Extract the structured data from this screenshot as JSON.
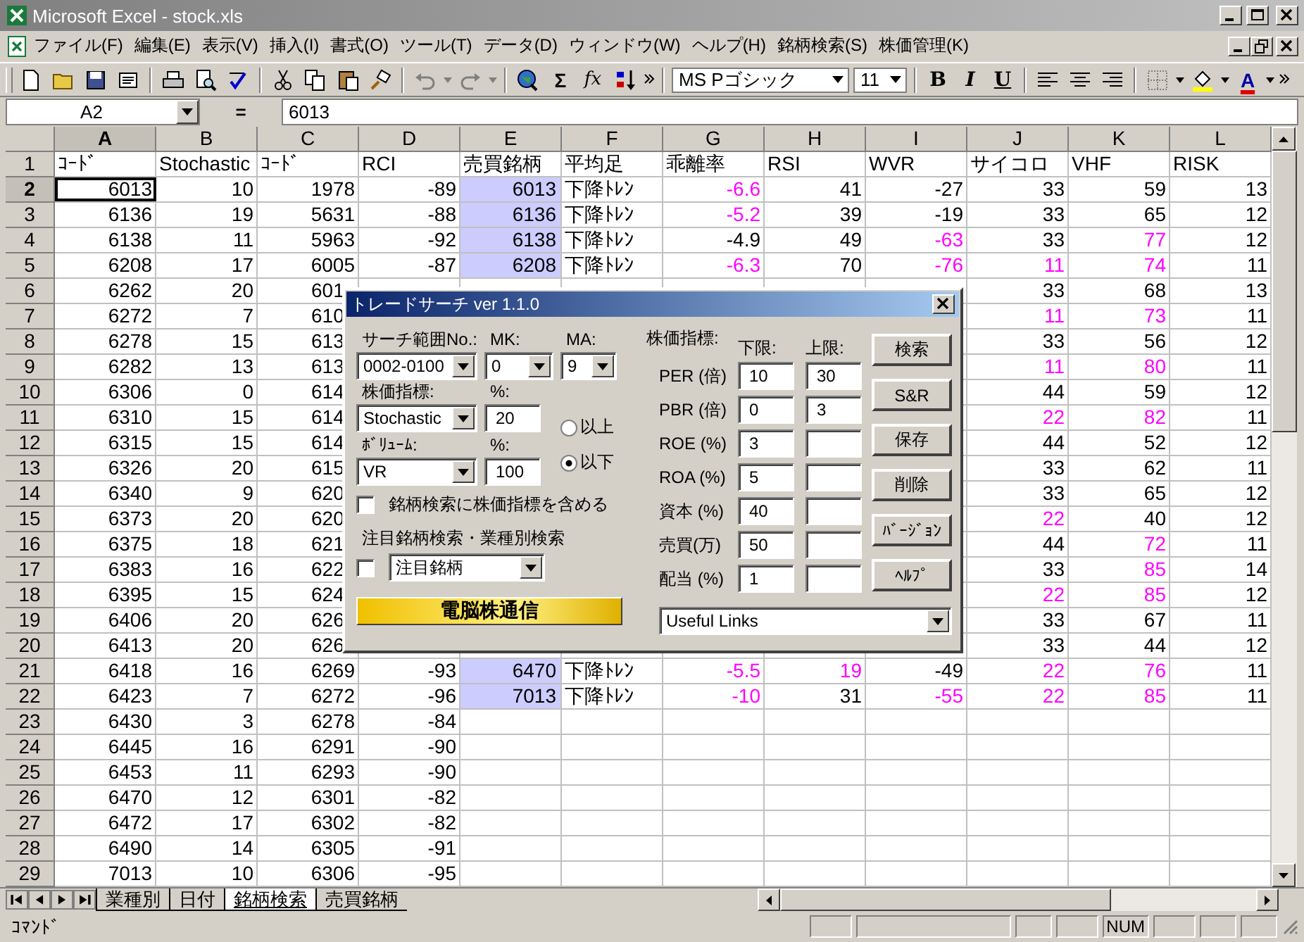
{
  "window": {
    "title": "Microsoft Excel - stock.xls"
  },
  "menu": [
    "ファイル(F)",
    "編集(E)",
    "表示(V)",
    "挿入(I)",
    "書式(O)",
    "ツール(T)",
    "データ(D)",
    "ウィンドウ(W)",
    "ヘルプ(H)",
    "銘柄検索(S)",
    "株価管理(K)"
  ],
  "toolbar": {
    "sum": "Σ",
    "function": "fx",
    "font": "MS Pゴシック",
    "size": "11",
    "bold": "B",
    "italic": "I",
    "underline": "U",
    "font_color": "A"
  },
  "formula_bar": {
    "name_box": "A2",
    "equals": "=",
    "value": "6013"
  },
  "columns": [
    {
      "letter": "A",
      "selected": true,
      "highlighted": false
    },
    {
      "letter": "B",
      "selected": false,
      "highlighted": false
    },
    {
      "letter": "C",
      "selected": false,
      "highlighted": false
    },
    {
      "letter": "D",
      "selected": false,
      "highlighted": false
    },
    {
      "letter": "E",
      "selected": false,
      "highlighted": true
    },
    {
      "letter": "F",
      "selected": false,
      "highlighted": false
    },
    {
      "letter": "G",
      "selected": false,
      "highlighted": false
    },
    {
      "letter": "H",
      "selected": false,
      "highlighted": false
    },
    {
      "letter": "I",
      "selected": false,
      "highlighted": false
    },
    {
      "letter": "J",
      "selected": false,
      "highlighted": false
    },
    {
      "letter": "K",
      "selected": false,
      "highlighted": false
    },
    {
      "letter": "L",
      "selected": false,
      "highlighted": false
    }
  ],
  "rows": [
    {
      "number": "1",
      "selected": false,
      "covered": false,
      "shaded": false,
      "cells": [
        "ｺｰﾄﾞ",
        "Stochastic",
        "ｺｰﾄﾞ",
        "RCI",
        "売買銘柄",
        "平均足",
        "乖離率",
        "RSI",
        "WVR",
        "サイコロ",
        "VHF",
        "RISK"
      ],
      "pink": [
        false,
        false,
        false,
        false,
        false,
        false,
        false,
        false,
        false,
        false,
        false,
        false
      ]
    },
    {
      "number": "2",
      "selected": true,
      "covered": false,
      "shaded": true,
      "cells": [
        "6013",
        "10",
        "1978",
        "-89",
        "6013",
        "下降ﾄﾚﾝ",
        "-6.6",
        "41",
        "-27",
        "33",
        "59",
        "13"
      ],
      "pink": [
        false,
        false,
        false,
        false,
        false,
        false,
        true,
        false,
        false,
        false,
        false,
        false
      ]
    },
    {
      "number": "3",
      "selected": false,
      "covered": false,
      "shaded": true,
      "cells": [
        "6136",
        "19",
        "5631",
        "-88",
        "6136",
        "下降ﾄﾚﾝ",
        "-5.2",
        "39",
        "-19",
        "33",
        "65",
        "12"
      ],
      "pink": [
        false,
        false,
        false,
        false,
        false,
        false,
        true,
        false,
        false,
        false,
        false,
        false
      ]
    },
    {
      "number": "4",
      "selected": false,
      "covered": false,
      "shaded": true,
      "cells": [
        "6138",
        "11",
        "5963",
        "-92",
        "6138",
        "下降ﾄﾚﾝ",
        "-4.9",
        "49",
        "-63",
        "33",
        "77",
        "12"
      ],
      "pink": [
        false,
        false,
        false,
        false,
        false,
        false,
        false,
        false,
        true,
        false,
        true,
        false
      ]
    },
    {
      "number": "5",
      "selected": false,
      "covered": false,
      "shaded": true,
      "cells": [
        "6208",
        "17",
        "6005",
        "-87",
        "6208",
        "下降ﾄﾚﾝ",
        "-6.3",
        "70",
        "-76",
        "11",
        "74",
        "11"
      ],
      "pink": [
        false,
        false,
        false,
        false,
        false,
        false,
        true,
        false,
        true,
        true,
        true,
        false
      ]
    },
    {
      "number": "6",
      "selected": false,
      "covered": true,
      "shaded": true,
      "cells": [
        "6262",
        "20",
        "601",
        "33",
        "68",
        "13"
      ],
      "pink": [
        false,
        false,
        false,
        false,
        false,
        false
      ]
    },
    {
      "number": "7",
      "selected": false,
      "covered": true,
      "shaded": true,
      "cells": [
        "6272",
        "7",
        "610",
        "11",
        "73",
        "11"
      ],
      "pink": [
        false,
        false,
        false,
        true,
        true,
        false
      ]
    },
    {
      "number": "8",
      "selected": false,
      "covered": true,
      "shaded": true,
      "cells": [
        "6278",
        "15",
        "613",
        "33",
        "56",
        "12"
      ],
      "pink": [
        false,
        false,
        false,
        false,
        false,
        false
      ]
    },
    {
      "number": "9",
      "selected": false,
      "covered": true,
      "shaded": true,
      "cells": [
        "6282",
        "13",
        "613",
        "11",
        "80",
        "11"
      ],
      "pink": [
        false,
        false,
        false,
        true,
        true,
        false
      ]
    },
    {
      "number": "10",
      "selected": false,
      "covered": true,
      "shaded": true,
      "cells": [
        "6306",
        "0",
        "614",
        "44",
        "59",
        "12"
      ],
      "pink": [
        false,
        false,
        false,
        false,
        false,
        false
      ]
    },
    {
      "number": "11",
      "selected": false,
      "covered": true,
      "shaded": true,
      "cells": [
        "6310",
        "15",
        "614",
        "22",
        "82",
        "11"
      ],
      "pink": [
        false,
        false,
        false,
        true,
        true,
        false
      ]
    },
    {
      "number": "12",
      "selected": false,
      "covered": true,
      "shaded": true,
      "cells": [
        "6315",
        "15",
        "614",
        "44",
        "52",
        "12"
      ],
      "pink": [
        false,
        false,
        false,
        false,
        false,
        false
      ]
    },
    {
      "number": "13",
      "selected": false,
      "covered": true,
      "shaded": true,
      "cells": [
        "6326",
        "20",
        "615",
        "33",
        "62",
        "11"
      ],
      "pink": [
        false,
        false,
        false,
        false,
        false,
        false
      ]
    },
    {
      "number": "14",
      "selected": false,
      "covered": true,
      "shaded": true,
      "cells": [
        "6340",
        "9",
        "620",
        "33",
        "65",
        "12"
      ],
      "pink": [
        false,
        false,
        false,
        false,
        false,
        false
      ]
    },
    {
      "number": "15",
      "selected": false,
      "covered": true,
      "shaded": true,
      "cells": [
        "6373",
        "20",
        "620",
        "22",
        "40",
        "12"
      ],
      "pink": [
        false,
        false,
        false,
        true,
        false,
        false
      ]
    },
    {
      "number": "16",
      "selected": false,
      "covered": true,
      "shaded": true,
      "cells": [
        "6375",
        "18",
        "621",
        "44",
        "72",
        "11"
      ],
      "pink": [
        false,
        false,
        false,
        false,
        true,
        false
      ]
    },
    {
      "number": "17",
      "selected": false,
      "covered": true,
      "shaded": true,
      "cells": [
        "6383",
        "16",
        "622",
        "33",
        "85",
        "14"
      ],
      "pink": [
        false,
        false,
        false,
        false,
        true,
        false
      ]
    },
    {
      "number": "18",
      "selected": false,
      "covered": true,
      "shaded": true,
      "cells": [
        "6395",
        "15",
        "624",
        "22",
        "85",
        "12"
      ],
      "pink": [
        false,
        false,
        false,
        true,
        true,
        false
      ]
    },
    {
      "number": "19",
      "selected": false,
      "covered": true,
      "shaded": true,
      "cells": [
        "6406",
        "20",
        "626",
        "33",
        "67",
        "11"
      ],
      "pink": [
        false,
        false,
        false,
        false,
        false,
        false
      ]
    },
    {
      "number": "20",
      "selected": false,
      "covered": true,
      "shaded": true,
      "cells": [
        "6413",
        "20",
        "626",
        "33",
        "44",
        "12"
      ],
      "pink": [
        false,
        false,
        false,
        false,
        false,
        false
      ]
    },
    {
      "number": "21",
      "selected": false,
      "covered": false,
      "shaded": true,
      "cells": [
        "6418",
        "16",
        "6269",
        "-93",
        "6470",
        "下降ﾄﾚﾝ",
        "-5.5",
        "19",
        "-49",
        "22",
        "76",
        "11"
      ],
      "pink": [
        false,
        false,
        false,
        false,
        false,
        false,
        true,
        true,
        false,
        true,
        true,
        false
      ]
    },
    {
      "number": "22",
      "selected": false,
      "covered": false,
      "shaded": true,
      "cells": [
        "6423",
        "7",
        "6272",
        "-96",
        "7013",
        "下降ﾄﾚﾝ",
        "-10",
        "31",
        "-55",
        "22",
        "85",
        "11"
      ],
      "pink": [
        false,
        false,
        false,
        false,
        false,
        false,
        true,
        false,
        true,
        true,
        true,
        false
      ]
    },
    {
      "number": "23",
      "selected": false,
      "covered": false,
      "shaded": false,
      "cells": [
        "6430",
        "3",
        "6278",
        "-84"
      ],
      "pink": [
        false,
        false,
        false,
        false
      ]
    },
    {
      "number": "24",
      "selected": false,
      "covered": false,
      "shaded": false,
      "cells": [
        "6445",
        "16",
        "6291",
        "-90"
      ],
      "pink": [
        false,
        false,
        false,
        false
      ]
    },
    {
      "number": "25",
      "selected": false,
      "covered": false,
      "shaded": false,
      "cells": [
        "6453",
        "11",
        "6293",
        "-90"
      ],
      "pink": [
        false,
        false,
        false,
        false
      ]
    },
    {
      "number": "26",
      "selected": false,
      "covered": false,
      "shaded": false,
      "cells": [
        "6470",
        "12",
        "6301",
        "-82"
      ],
      "pink": [
        false,
        false,
        false,
        false
      ]
    },
    {
      "number": "27",
      "selected": false,
      "covered": false,
      "shaded": false,
      "cells": [
        "6472",
        "17",
        "6302",
        "-82"
      ],
      "pink": [
        false,
        false,
        false,
        false
      ]
    },
    {
      "number": "28",
      "selected": false,
      "covered": false,
      "shaded": false,
      "cells": [
        "6490",
        "14",
        "6305",
        "-91"
      ],
      "pink": [
        false,
        false,
        false,
        false
      ]
    },
    {
      "number": "29",
      "selected": false,
      "covered": false,
      "shaded": false,
      "cells": [
        "7013",
        "10",
        "6306",
        "-95"
      ],
      "pink": [
        false,
        false,
        false,
        false
      ]
    }
  ],
  "dialog": {
    "title": "トレードサーチ ver 1.1.0",
    "range": {
      "label": "サーチ範囲No.:",
      "value": "0002-0100"
    },
    "mk": {
      "label": "MK:",
      "value": "0"
    },
    "ma": {
      "label": "MA:",
      "value": "9"
    },
    "indicator": {
      "label": "株価指標:",
      "value": "Stochastic",
      "percent_label": "%:",
      "percent": "20"
    },
    "volume": {
      "label": "ﾎﾞﾘｭｰﾑ:",
      "value": "VR",
      "percent_label": "%:",
      "percent": "100"
    },
    "radios": [
      {
        "label": "以上",
        "selected": false
      },
      {
        "label": "以下",
        "selected": true
      }
    ],
    "include_checkbox": {
      "label": "銘柄検索に株価指標を含める",
      "checked": false
    },
    "watch": {
      "label": "注目銘柄検索・業種別検索",
      "checked": false,
      "value": "注目銘柄"
    },
    "banner_button": "電脳株通信",
    "filters_label": "株価指標:",
    "lower_label": "下限:",
    "upper_label": "上限:",
    "filters": [
      {
        "label": "PER (倍)",
        "lower": "10",
        "upper": "30"
      },
      {
        "label": "PBR (倍)",
        "lower": "0",
        "upper": "3"
      },
      {
        "label": "ROE (%)",
        "lower": "3"
      },
      {
        "label": "ROA (%)",
        "lower": "5"
      },
      {
        "label": "資本 (%)",
        "lower": "40"
      },
      {
        "label": "売買(万)",
        "lower": "50"
      },
      {
        "label": "配当 (%)",
        "lower": "1"
      }
    ],
    "buttons": [
      "検索",
      "S&R",
      "保存",
      "削除",
      "ﾊﾞｰｼﾞｮﾝ",
      "ﾍﾙﾌﾟ"
    ],
    "links": {
      "value": "Useful Links"
    }
  },
  "sheet_tabs": [
    {
      "label": "業種別",
      "selected": false
    },
    {
      "label": "日付",
      "selected": false
    },
    {
      "label": "銘柄検索",
      "selected": true
    },
    {
      "label": "売買銘柄",
      "selected": false
    }
  ],
  "status_bar": {
    "mode": "ｺﾏﾝﾄﾞ",
    "indicator": "NUM"
  }
}
